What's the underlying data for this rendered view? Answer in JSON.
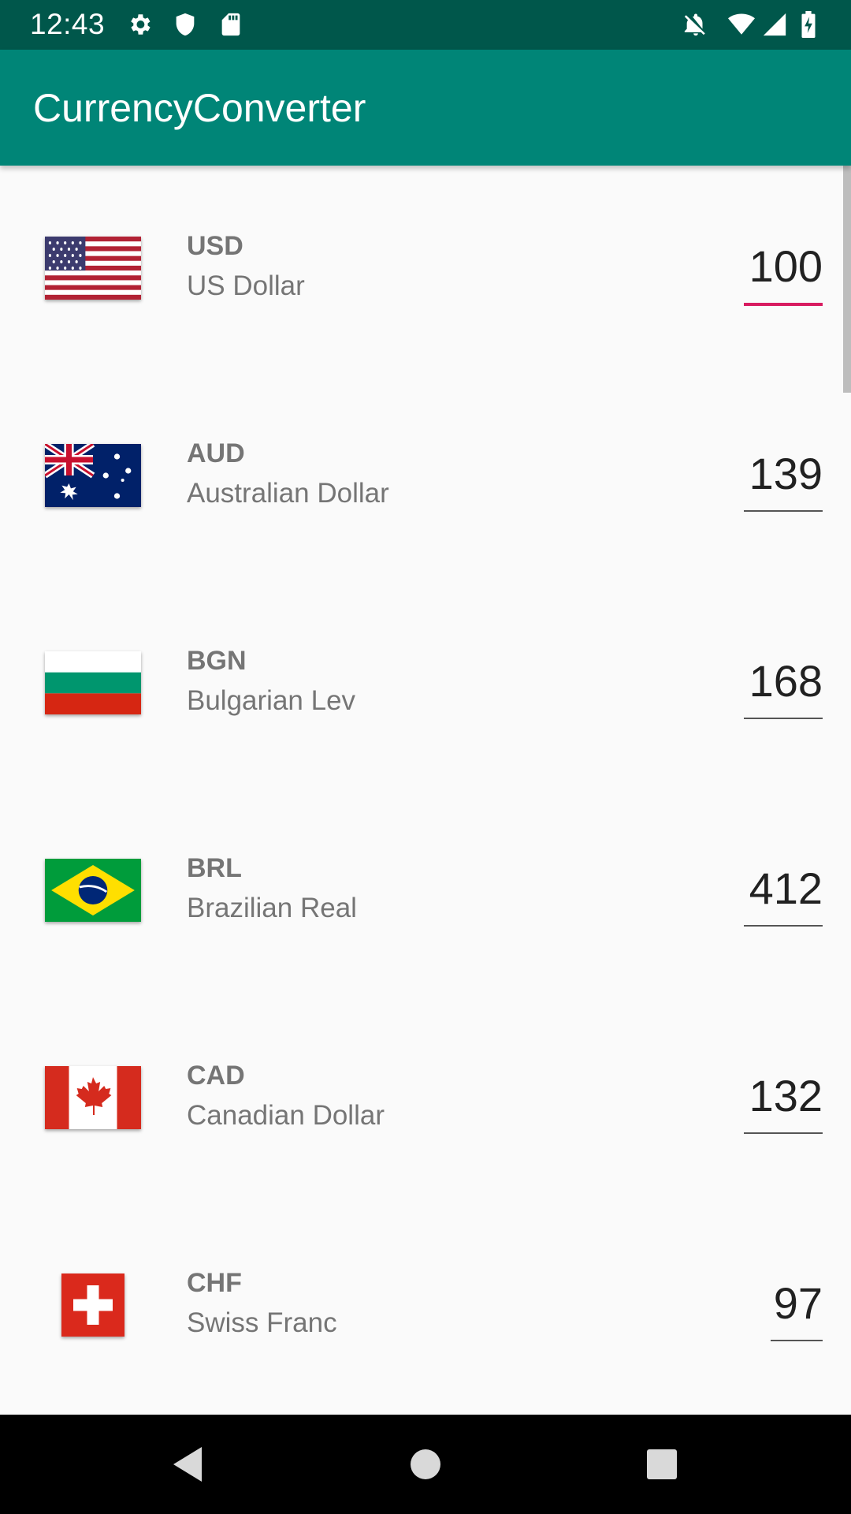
{
  "status_bar": {
    "time": "12:43",
    "left_icons": [
      "gear-icon",
      "shield-icon",
      "sd-card-icon"
    ],
    "right_icons": [
      "notifications-off-icon",
      "wifi-icon",
      "signal-icon",
      "battery-charging-icon"
    ]
  },
  "app_bar": {
    "title": "CurrencyConverter",
    "color": "#008577",
    "status_color": "#00574b"
  },
  "accent_color": "#d81b60",
  "currencies": [
    {
      "code": "USD",
      "name": "US Dollar",
      "amount": "100",
      "flag": "us-flag-icon",
      "focused": true
    },
    {
      "code": "AUD",
      "name": "Australian Dollar",
      "amount": "139",
      "flag": "australia-flag-icon",
      "focused": false
    },
    {
      "code": "BGN",
      "name": "Bulgarian Lev",
      "amount": "168",
      "flag": "bulgaria-flag-icon",
      "focused": false
    },
    {
      "code": "BRL",
      "name": "Brazilian Real",
      "amount": "412",
      "flag": "brazil-flag-icon",
      "focused": false
    },
    {
      "code": "CAD",
      "name": "Canadian Dollar",
      "amount": "132",
      "flag": "canada-flag-icon",
      "focused": false
    },
    {
      "code": "CHF",
      "name": "Swiss Franc",
      "amount": "97",
      "flag": "switzerland-flag-icon",
      "focused": false
    }
  ],
  "nav_bar": {
    "buttons": [
      "back-icon",
      "home-icon",
      "recents-icon"
    ]
  }
}
